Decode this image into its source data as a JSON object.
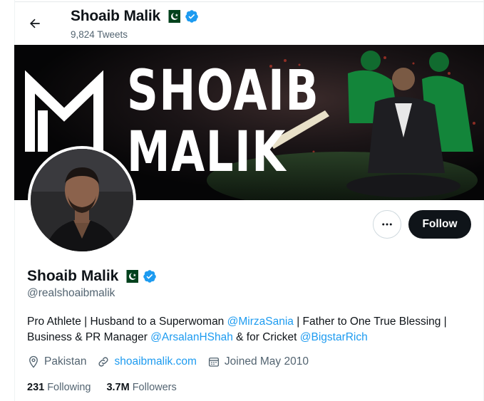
{
  "header": {
    "name": "Shoaib Malik",
    "tweet_count": "9,824 Tweets",
    "back_icon": "arrow-left-icon"
  },
  "banner": {
    "line1": "SHOAIB",
    "line2": "MALIK"
  },
  "actions": {
    "more_icon": "more-dots-icon",
    "follow_label": "Follow"
  },
  "profile": {
    "name": "Shoaib Malik",
    "handle": "@realshoaibmalik",
    "bio": {
      "part1": "Pro Athlete | Husband to a Superwoman ",
      "mention1": "@MirzaSania",
      "part2": " | Father to One True Blessing | Business & PR Manager ",
      "mention2": "@ArsalanHShah",
      "part3": " & for Cricket ",
      "mention3": "@BigstarRich"
    },
    "location": "Pakistan",
    "website": "shoaibmalik.com",
    "joined": "Joined May 2010",
    "following_count": "231",
    "following_label": "Following",
    "followers_count": "3.7M",
    "followers_label": "Followers"
  },
  "colors": {
    "accent": "#1d9bf0",
    "text": "#0f1419",
    "muted": "#536471",
    "follow_bg": "#0f1419",
    "flag_green": "#01411c"
  }
}
